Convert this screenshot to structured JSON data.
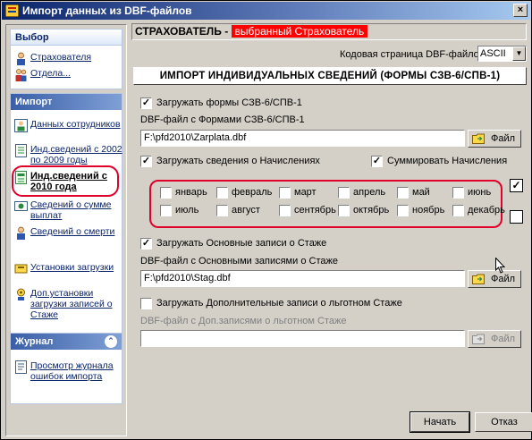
{
  "window": {
    "title": "Импорт данных из DBF-файлов",
    "close_label": "×"
  },
  "sidebar": {
    "vybor": {
      "header": "Выбор",
      "items": [
        {
          "label": "Страхователя"
        },
        {
          "label": "Отдела..."
        }
      ]
    },
    "import": {
      "header": "Импорт",
      "items": [
        {
          "label": "Данных сотрудников"
        },
        {
          "label": "Инд.сведений с 2002 по 2009 годы"
        },
        {
          "label": "Инд.сведений с 2010 года"
        },
        {
          "label": "Сведений о сумме выплат"
        },
        {
          "label": "Сведений о смерти"
        },
        {
          "label": "Установки загрузки"
        },
        {
          "label": "Доп.установки загрузки записей о Стаже"
        }
      ]
    },
    "journal": {
      "header": "Журнал",
      "collapse_label": "⌃",
      "items": [
        {
          "label": "Просмотр журнала ошибок импорта"
        }
      ]
    }
  },
  "header": {
    "prefix": "СТРАХОВАТЕЛЬ - ",
    "selected": "выбранный Страхователь"
  },
  "codepage": {
    "label": "Кодовая страница DBF-файлов:",
    "value": "ASCII",
    "arrow": "▼"
  },
  "section_title": "ИМПОРТ ИНДИВИДУАЛЬНЫХ СВЕДЕНИЙ (ФОРМЫ СЗВ-6/СПВ-1)",
  "forms": {
    "checkbox_label": "Загружать формы СЗВ-6/СПВ-1",
    "checked": true,
    "field_label": "DBF-файл с Формами СЗВ-6/СПВ-1",
    "path": "F:\\pfd2010\\Zarplata.dbf",
    "file_button": "Файл"
  },
  "accruals": {
    "checkbox_label": "Загружать сведения о Начислениях",
    "checked": true,
    "sum_label": "Суммировать Начисления",
    "sum_checked": true
  },
  "months": [
    "январь",
    "февраль",
    "март",
    "апрель",
    "май",
    "июнь",
    "июль",
    "август",
    "сентябрь",
    "октябрь",
    "ноябрь",
    "декабрь"
  ],
  "select_all_mark": "✓",
  "main_stazh": {
    "checkbox_label": "Загружать Основные записи о Стаже",
    "checked": true,
    "field_label": "DBF-файл с Основными записями о Стаже",
    "path": "F:\\pfd2010\\Stag.dbf",
    "file_button": "Файл"
  },
  "extra_stazh": {
    "checkbox_label": "Загружать Дополнительные записи о льготном Стаже",
    "checked": false,
    "field_label": "DBF-файл с Доп.записями о льготном Стаже",
    "path": "",
    "file_button": "Файл"
  },
  "buttons": {
    "start": "Начать",
    "cancel": "Отказ"
  },
  "check_mark": "✓",
  "colors": {
    "accent_red": "#e0002a",
    "title_blue": "#0a246a"
  }
}
